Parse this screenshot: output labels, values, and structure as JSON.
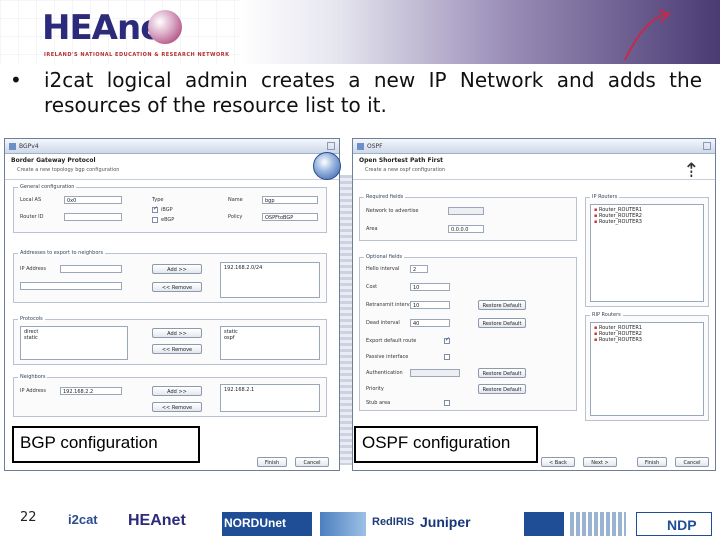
{
  "header": {
    "logo_text": "HEAnet",
    "logo_tagline": "IRELAND'S NATIONAL EDUCATION & RESEARCH NETWORK"
  },
  "slide": {
    "bullet": "i2cat logical admin creates a new IP Network and adds the resources of the resource list to it.",
    "page_number": "22"
  },
  "bgp_window": {
    "title": "BGPv4",
    "heading": "Border Gateway Protocol",
    "subtitle": "Create a new topology bgp configuration",
    "groups": {
      "general": "General configuration",
      "addresses": "Addresses to export to neighbors",
      "protocols": "Protocols",
      "neighbors": "Neighbors"
    },
    "fields": {
      "local_as_label": "Local AS",
      "local_as_value": "0x0",
      "router_id_label": "Router ID",
      "type_label": "Type",
      "type_ibgp": "iBGP",
      "type_ebgp": "eBGP",
      "name_label": "Name",
      "name_value": "bgp",
      "policy_label": "Policy",
      "policy_value": "OSPFtoBGP",
      "ip_address_label": "IP Address",
      "address_list": "192.168.2.0/24",
      "protocols_list": [
        "direct",
        "static"
      ],
      "protocols_right": [
        "static",
        "ospf"
      ],
      "neighbor_ip_label": "IP Address",
      "neighbor_ip_value": "192.168.2.2",
      "neighbor_list": "192.168.2.1"
    },
    "buttons": {
      "add1": "Add >>",
      "remove1": "<< Remove",
      "add2": "Add >>",
      "remove2": "<< Remove",
      "add3": "Add >>",
      "remove3": "<< Remove",
      "finish": "Finish",
      "cancel": "Cancel"
    },
    "caption": "BGP configuration"
  },
  "ospf_window": {
    "title": "OSPF",
    "heading": "Open Shortest Path First",
    "subtitle": "Create a new ospf configuration",
    "groups": {
      "required": "Required fields",
      "optional": "Optional fields",
      "routers": "IP Routers",
      "rip": "RIP Routers"
    },
    "fields": {
      "network_label": "Network to advertise",
      "area_label": "Area",
      "area_value": "0.0.0.0",
      "hello_label": "Hello interval",
      "hello_value": "2",
      "cost_label": "Cost",
      "cost_value": "10",
      "retransmit_label": "Retransmit interval",
      "retransmit_value": "10",
      "dead_label": "Dead interval",
      "dead_value": "40",
      "opt1_label": "Export default route",
      "opt2_label": "Passive interface",
      "auth_label": "Authentication",
      "priority_label": "Priority",
      "stub_label": "Stub area",
      "routers": [
        "Router_ROUTER1",
        "Router_ROUTER2",
        "Router_ROUTER3"
      ],
      "rip_routers": [
        "Router_ROUTER1",
        "Router_ROUTER2",
        "Router_ROUTER3"
      ]
    },
    "buttons": {
      "restore1": "Restore Default",
      "restore2": "Restore Default",
      "restore3": "Restore Default",
      "restore4": "Restore Default",
      "back": "< Back",
      "next": "Next >",
      "finish": "Finish",
      "cancel": "Cancel"
    },
    "caption": "OSPF configuration"
  },
  "partners": [
    "i2cat",
    "HEAnet",
    "NORDUnet",
    "",
    "RedIRIS",
    "Juniper",
    "",
    "",
    "NDP"
  ]
}
